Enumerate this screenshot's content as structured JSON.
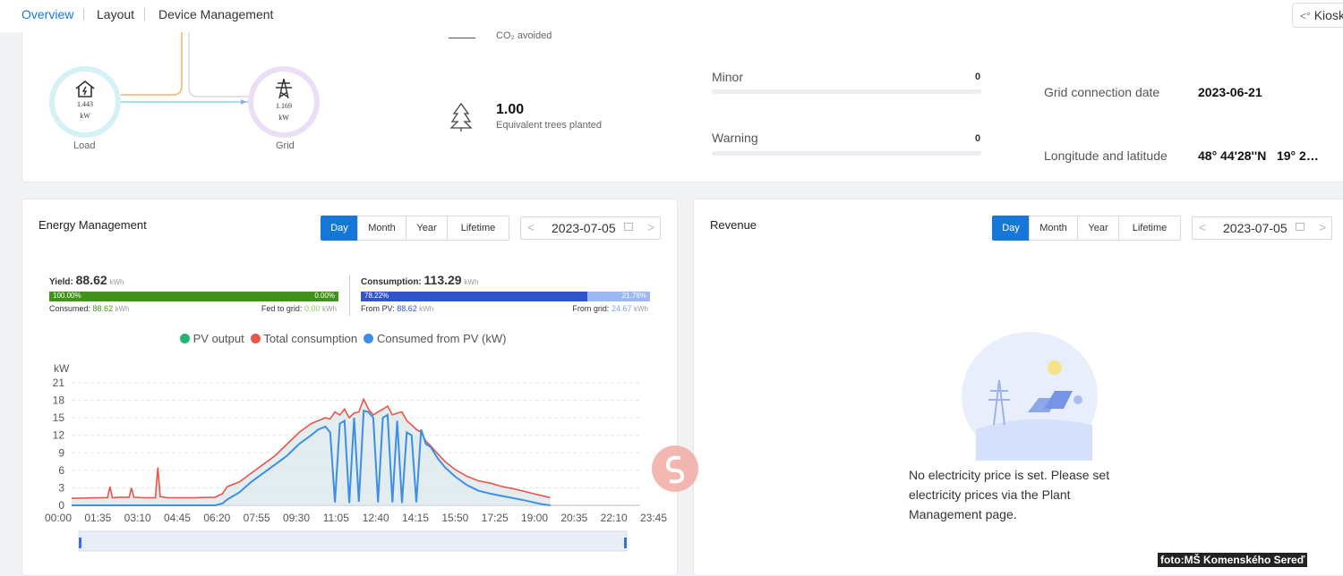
{
  "nav": {
    "overview": "Overview",
    "layout": "Layout",
    "device_management": "Device Management",
    "kiosk": "Kiosk"
  },
  "top_card": {
    "load": {
      "value": "1.443",
      "unit": "kW",
      "label": "Load"
    },
    "grid": {
      "value": "1.169",
      "unit": "kW",
      "label": "Grid"
    },
    "co2_label": "CO₂ avoided",
    "trees": {
      "value": "1.00",
      "label": "Equivalent trees planted"
    },
    "alarms": [
      {
        "label": "Minor",
        "count": "0"
      },
      {
        "label": "Warning",
        "count": "0"
      }
    ],
    "info": [
      {
        "label": "Grid connection date",
        "value": "2023-06-21"
      },
      {
        "label": "Longitude and latitude",
        "value": "48° 44'28''N   19° 2…"
      }
    ]
  },
  "energy": {
    "title": "Energy Management",
    "tabs": [
      "Day",
      "Month",
      "Year",
      "Lifetime"
    ],
    "active_tab": "Day",
    "date": "2023-07-05",
    "yield": {
      "label": "Yield:",
      "value": "88.62",
      "unit": "kWh",
      "consumed_pct": "100.00%",
      "fed_pct": "0.00%",
      "consumed_frac": 1.0,
      "consumed_label": "Consumed:",
      "consumed_value": "88.62",
      "consumed_unit": "kWh",
      "fed_label": "Fed to grid:",
      "fed_value": "0.00",
      "fed_unit": "kWh"
    },
    "consumption": {
      "label": "Consumption:",
      "value": "113.29",
      "unit": "kWh",
      "pv_pct": "78.22%",
      "grid_pct": "21.78%",
      "pv_frac": 0.7822,
      "pv_label": "From PV:",
      "pv_value": "88.62",
      "pv_unit": "kWh",
      "grid_label": "From grid:",
      "grid_value": "24.67",
      "grid_unit": "kWh"
    },
    "legend": [
      {
        "name": "PV output",
        "color": "#22b573"
      },
      {
        "name": "Total consumption",
        "color": "#e8564a"
      },
      {
        "name": "Consumed from PV (kW)",
        "color": "#3d8fe6"
      }
    ]
  },
  "chart_data": {
    "type": "line",
    "ylabel": "kW",
    "yticks": [
      "21",
      "18",
      "15",
      "12",
      "9",
      "6",
      "3",
      "0"
    ],
    "ylim": [
      0,
      21
    ],
    "xticks": [
      "00:00",
      "01:35",
      "03:10",
      "04:45",
      "06:20",
      "07:55",
      "09:30",
      "11:05",
      "12:40",
      "14:15",
      "15:50",
      "17:25",
      "19:00",
      "20:35",
      "22:10",
      "23:45"
    ],
    "x_hours": [
      0,
      1,
      1.5,
      1.6,
      1.7,
      2,
      2.4,
      2.5,
      2.6,
      3,
      3.5,
      3.6,
      3.7,
      4,
      5,
      6,
      6.3,
      6.5,
      7,
      7.5,
      8,
      8.5,
      9,
      9.5,
      10,
      10.3,
      10.6,
      10.8,
      11,
      11.2,
      11.4,
      11.6,
      11.8,
      12,
      12.2,
      12.4,
      12.6,
      12.8,
      13,
      13.2,
      13.4,
      13.6,
      13.8,
      14,
      14.2,
      14.4,
      14.6,
      14.8,
      15,
      15.3,
      15.6,
      16,
      16.5,
      17,
      17.5,
      18,
      18.5,
      19,
      19.3,
      19.5,
      19.8,
      20
    ],
    "series": [
      {
        "name": "Total consumption",
        "values": [
          1.2,
          1.3,
          1.3,
          3.2,
          1.3,
          1.4,
          1.4,
          3.0,
          1.4,
          1.3,
          1.3,
          6.5,
          1.5,
          1.3,
          1.3,
          1.4,
          2.0,
          3.2,
          4.0,
          5.5,
          7.0,
          8.5,
          10.5,
          12.5,
          14.0,
          14.5,
          15.0,
          14.8,
          16.0,
          15.5,
          16.5,
          15.0,
          15.8,
          16.0,
          18.2,
          16.5,
          15.5,
          16.0,
          16.5,
          17.0,
          15.5,
          15.8,
          16.0,
          14.5,
          13.8,
          13.0,
          12.5,
          11.0,
          10.2,
          8.8,
          7.5,
          6.2,
          5.0,
          4.2,
          3.8,
          3.2,
          2.8,
          2.3,
          2.0,
          1.8,
          1.5,
          1.3
        ]
      },
      {
        "name": "Consumed from PV (kW)",
        "values": [
          0,
          0,
          0,
          0,
          0,
          0,
          0,
          0,
          0,
          0,
          0,
          0,
          0,
          0,
          0,
          0,
          0.3,
          1.0,
          2.2,
          4.0,
          5.5,
          7.0,
          8.5,
          10.5,
          12.0,
          13.0,
          13.5,
          12.5,
          0.5,
          14.0,
          14.5,
          0.4,
          15.0,
          0.6,
          16.2,
          16.0,
          15.0,
          0.5,
          15.0,
          15.5,
          0.5,
          14.5,
          0.4,
          12.5,
          12.0,
          0.5,
          13.0,
          10.5,
          10.0,
          8.0,
          6.5,
          5.0,
          3.5,
          2.5,
          2.0,
          1.6,
          1.2,
          0.8,
          0.5,
          0.3,
          0.1,
          0
        ]
      }
    ]
  },
  "revenue": {
    "title": "Revenue",
    "tabs": [
      "Day",
      "Month",
      "Year",
      "Lifetime"
    ],
    "active_tab": "Day",
    "date": "2023-07-05",
    "empty_message": "No electricity price is set. Please set electricity prices via the Plant Management page."
  },
  "watermark": "foto:MŠ Komenského Sereď"
}
